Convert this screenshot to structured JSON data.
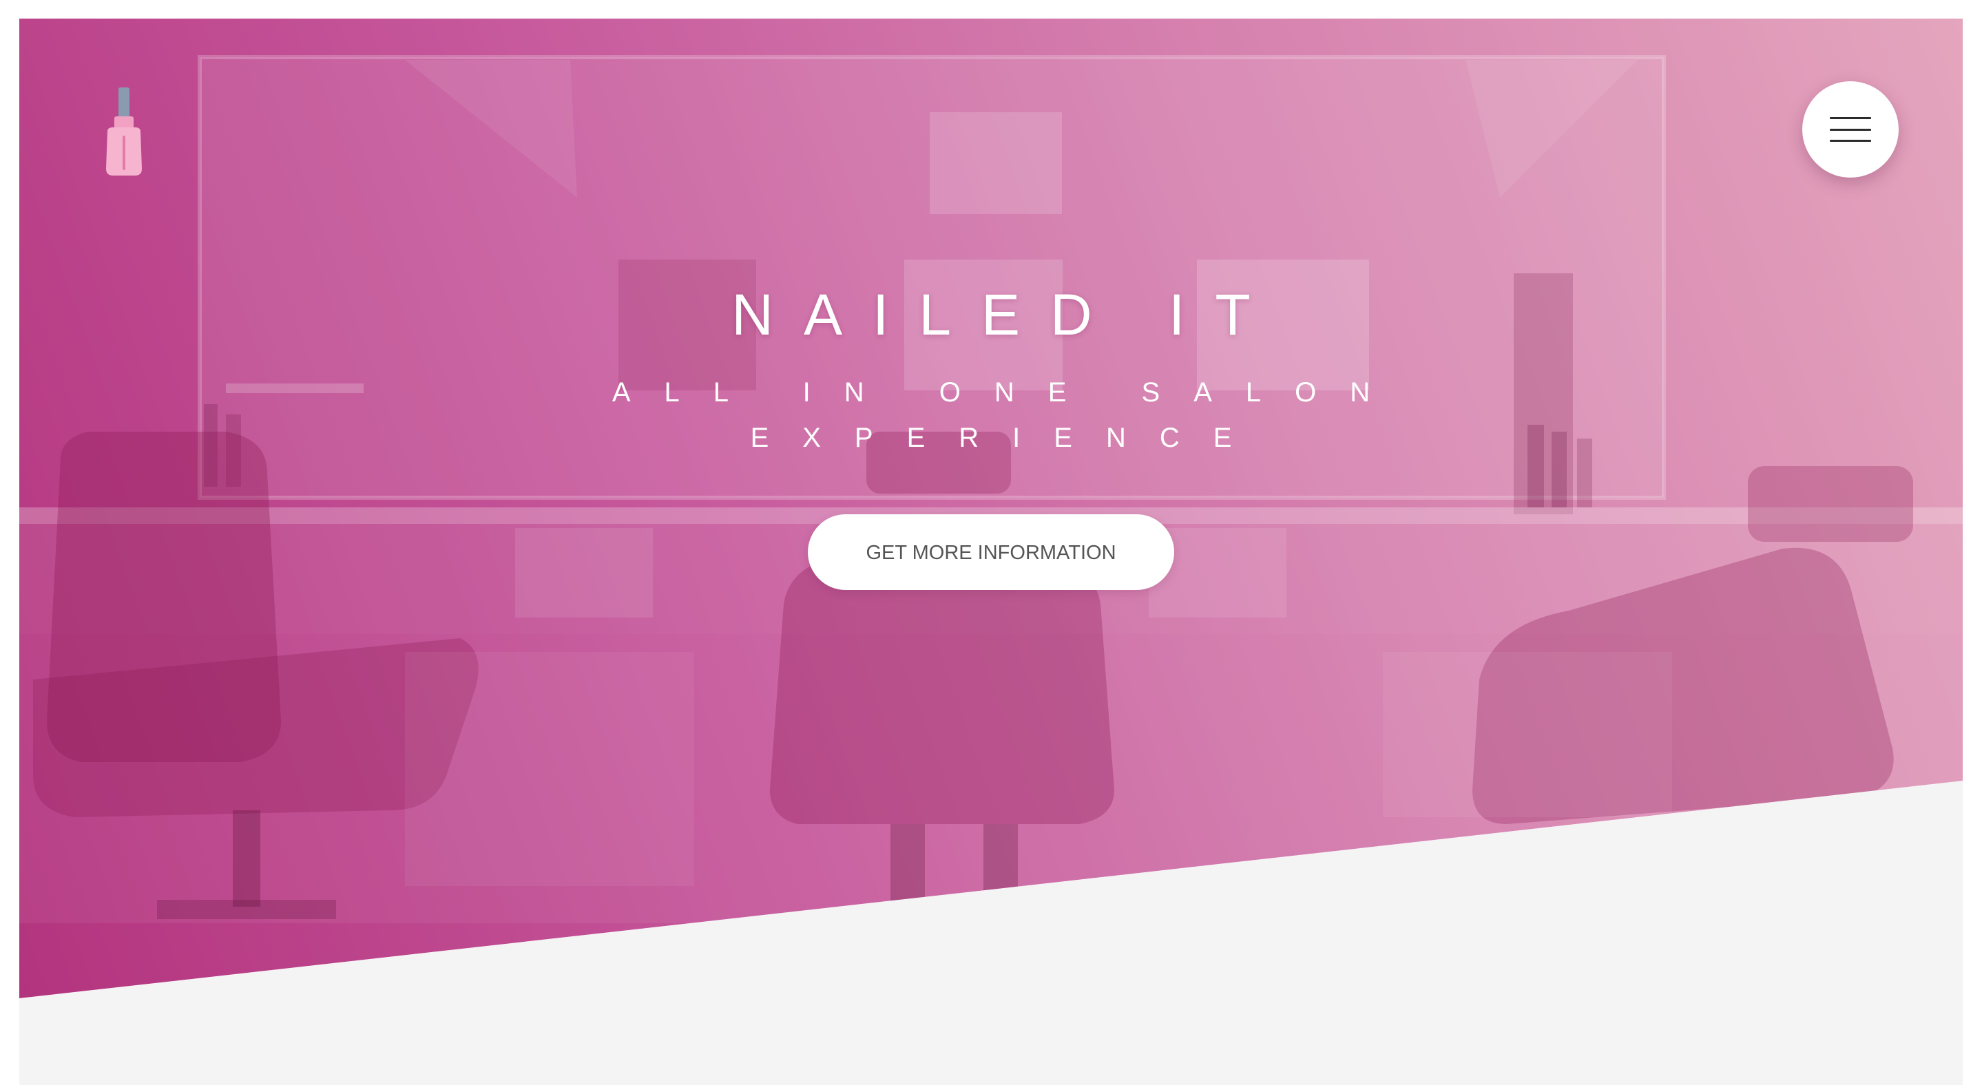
{
  "brand": {
    "logo_icon": "nail-polish-icon",
    "title": "NAILED IT",
    "tagline": "ALL IN ONE SALON EXPERIENCE"
  },
  "header": {
    "menu_icon": "hamburger-menu-icon"
  },
  "hero": {
    "cta_label": "GET MORE INFORMATION",
    "background": "salon-interior-photo",
    "overlay_colors": [
      "#b3347e",
      "#c6579b",
      "#e4a5bd"
    ]
  },
  "colors": {
    "accent": "#c6579b",
    "page_background": "#f5f4f5",
    "button_text": "#555555"
  }
}
